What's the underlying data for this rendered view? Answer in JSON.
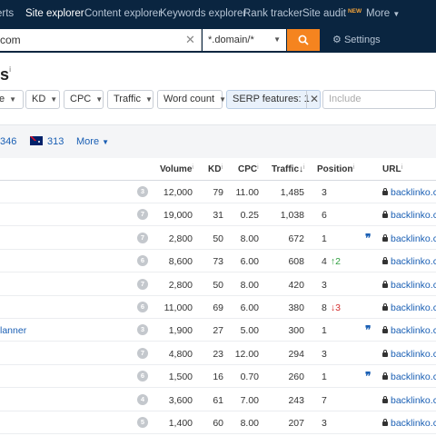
{
  "nav": {
    "items": [
      {
        "label": "erts",
        "active": false
      },
      {
        "label": "Site explorer",
        "active": true
      },
      {
        "label": "Content explorer",
        "active": false
      },
      {
        "label": "Keywords explorer",
        "active": false
      },
      {
        "label": "Rank tracker",
        "active": false
      },
      {
        "label": "Site audit",
        "active": false,
        "badge": "NEW"
      },
      {
        "label": "More",
        "active": false
      }
    ]
  },
  "search": {
    "url_value": "com",
    "mode_value": "*.domain/*",
    "settings_label": "Settings"
  },
  "page": {
    "title": "s",
    "title_info": "i"
  },
  "filters": {
    "chips": [
      "e",
      "KD",
      "CPC",
      "Traffic",
      "Word count"
    ],
    "serp_label": "SERP features: 1",
    "include_placeholder": "Include"
  },
  "countries": {
    "count1": "346",
    "count2": "313",
    "more_label": "More"
  },
  "table": {
    "headers": {
      "volume": "Volume",
      "kd": "KD",
      "cpc": "CPC",
      "traffic": "Traffic",
      "position": "Position",
      "url": "URL"
    },
    "rows": [
      {
        "keyword": "",
        "badge": "3",
        "volume": "12,000",
        "kd": "79",
        "cpc": "11.00",
        "traffic": "1,485",
        "position": "3",
        "change": "",
        "change_dir": "",
        "snippet": false,
        "url": "backlinko.co"
      },
      {
        "keyword": "",
        "badge": "7",
        "volume": "19,000",
        "kd": "31",
        "cpc": "0.25",
        "traffic": "1,038",
        "position": "6",
        "change": "",
        "change_dir": "",
        "snippet": false,
        "url": "backlinko.co"
      },
      {
        "keyword": "",
        "badge": "7",
        "volume": "2,800",
        "kd": "50",
        "cpc": "8.00",
        "traffic": "672",
        "position": "1",
        "change": "",
        "change_dir": "",
        "snippet": true,
        "url": "backlinko.co"
      },
      {
        "keyword": "",
        "badge": "6",
        "volume": "8,600",
        "kd": "73",
        "cpc": "6.00",
        "traffic": "608",
        "position": "4",
        "change": "↑2",
        "change_dir": "up",
        "snippet": false,
        "url": "backlinko.co"
      },
      {
        "keyword": "",
        "badge": "7",
        "volume": "2,800",
        "kd": "50",
        "cpc": "8.00",
        "traffic": "420",
        "position": "3",
        "change": "",
        "change_dir": "",
        "snippet": false,
        "url": "backlinko.co"
      },
      {
        "keyword": "",
        "badge": "6",
        "volume": "11,000",
        "kd": "69",
        "cpc": "6.00",
        "traffic": "380",
        "position": "8",
        "change": "↓3",
        "change_dir": "down",
        "snippet": false,
        "url": "backlinko.co"
      },
      {
        "keyword": "lanner",
        "badge": "3",
        "volume": "1,900",
        "kd": "27",
        "cpc": "5.00",
        "traffic": "300",
        "position": "1",
        "change": "",
        "change_dir": "",
        "snippet": true,
        "url": "backlinko.co"
      },
      {
        "keyword": "",
        "badge": "7",
        "volume": "4,800",
        "kd": "23",
        "cpc": "12.00",
        "traffic": "294",
        "position": "3",
        "change": "",
        "change_dir": "",
        "snippet": false,
        "url": "backlinko.co"
      },
      {
        "keyword": "",
        "badge": "6",
        "volume": "1,500",
        "kd": "16",
        "cpc": "0.70",
        "traffic": "260",
        "position": "1",
        "change": "",
        "change_dir": "",
        "snippet": true,
        "url": "backlinko.co"
      },
      {
        "keyword": "",
        "badge": "4",
        "volume": "3,600",
        "kd": "61",
        "cpc": "7.00",
        "traffic": "243",
        "position": "7",
        "change": "",
        "change_dir": "",
        "snippet": false,
        "url": "backlinko.co"
      },
      {
        "keyword": "",
        "badge": "5",
        "volume": "1,400",
        "kd": "60",
        "cpc": "8.00",
        "traffic": "207",
        "position": "3",
        "change": "",
        "change_dir": "",
        "snippet": false,
        "url": "backlinko.co"
      }
    ]
  }
}
